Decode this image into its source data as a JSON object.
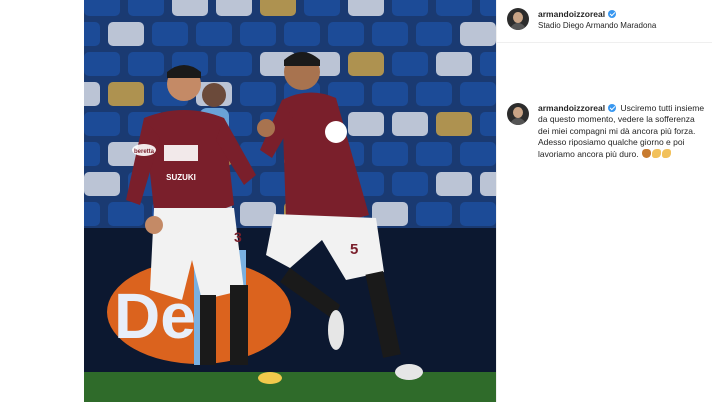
{
  "post": {
    "username": "armandoizzoreal",
    "location": "Stadio Diego Armando Maradona",
    "caption": "Usciremo tutti insieme da questo momento, vedere la sofferenza dei miei compagni mi dà ancora più forza. Adesso riposiamo qualche giorno e poi lavoriamo ancora più duro.",
    "caption_emojis": [
      "bull-icon",
      "flexed-biceps-icon",
      "flexed-biceps-icon"
    ]
  },
  "photo": {
    "jersey_number_left": "3",
    "jersey_number_right": "5",
    "sponsor_text": "SUZUKI",
    "sleeve_patch": "beretta",
    "ad_board_text": "De",
    "colors": {
      "jersey": "#7a1f2b",
      "shorts": "#f2f2f2",
      "seats_blue": "#1d4f9e",
      "seats_white": "#d8dde6",
      "pitch": "#2f6b2a",
      "board": "#0c1830"
    }
  }
}
